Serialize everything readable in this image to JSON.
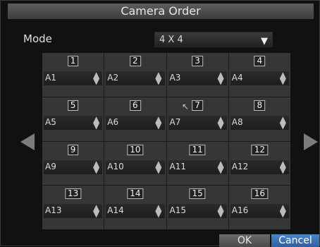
{
  "dialog": {
    "title": "Camera Order"
  },
  "mode": {
    "label": "Mode",
    "value": "4 X 4"
  },
  "grid": [
    {
      "num": "1",
      "value": "A1"
    },
    {
      "num": "2",
      "value": "A2"
    },
    {
      "num": "3",
      "value": "A3"
    },
    {
      "num": "4",
      "value": "A4"
    },
    {
      "num": "5",
      "value": "A5"
    },
    {
      "num": "6",
      "value": "A6"
    },
    {
      "num": "7",
      "value": "A7"
    },
    {
      "num": "8",
      "value": "A8"
    },
    {
      "num": "9",
      "value": "A9"
    },
    {
      "num": "10",
      "value": "A10"
    },
    {
      "num": "11",
      "value": "A11"
    },
    {
      "num": "12",
      "value": "A12"
    },
    {
      "num": "13",
      "value": "A13"
    },
    {
      "num": "14",
      "value": "A14"
    },
    {
      "num": "15",
      "value": "A15"
    },
    {
      "num": "16",
      "value": "A16"
    }
  ],
  "buttons": {
    "ok": "OK",
    "cancel": "Cancel"
  },
  "colors": {
    "cancel_accent": "#3a70b5",
    "cell_bg": "#363636"
  }
}
